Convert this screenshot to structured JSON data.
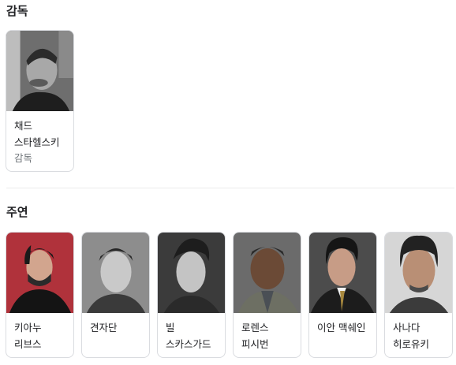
{
  "sections": {
    "director_title": "감독",
    "cast_title": "주연"
  },
  "director": {
    "name": "채드 스타헬스키",
    "role": "감독"
  },
  "cast": [
    {
      "name": "키아누 리브스"
    },
    {
      "name": "견자단"
    },
    {
      "name": "빌 스카스가드"
    },
    {
      "name": "로렌스 피시번"
    },
    {
      "name": "이안 맥쉐인"
    },
    {
      "name": "사나다 히로유키"
    }
  ],
  "colors": {
    "text": "#202124",
    "muted": "#70757a",
    "border": "#dadce0"
  }
}
